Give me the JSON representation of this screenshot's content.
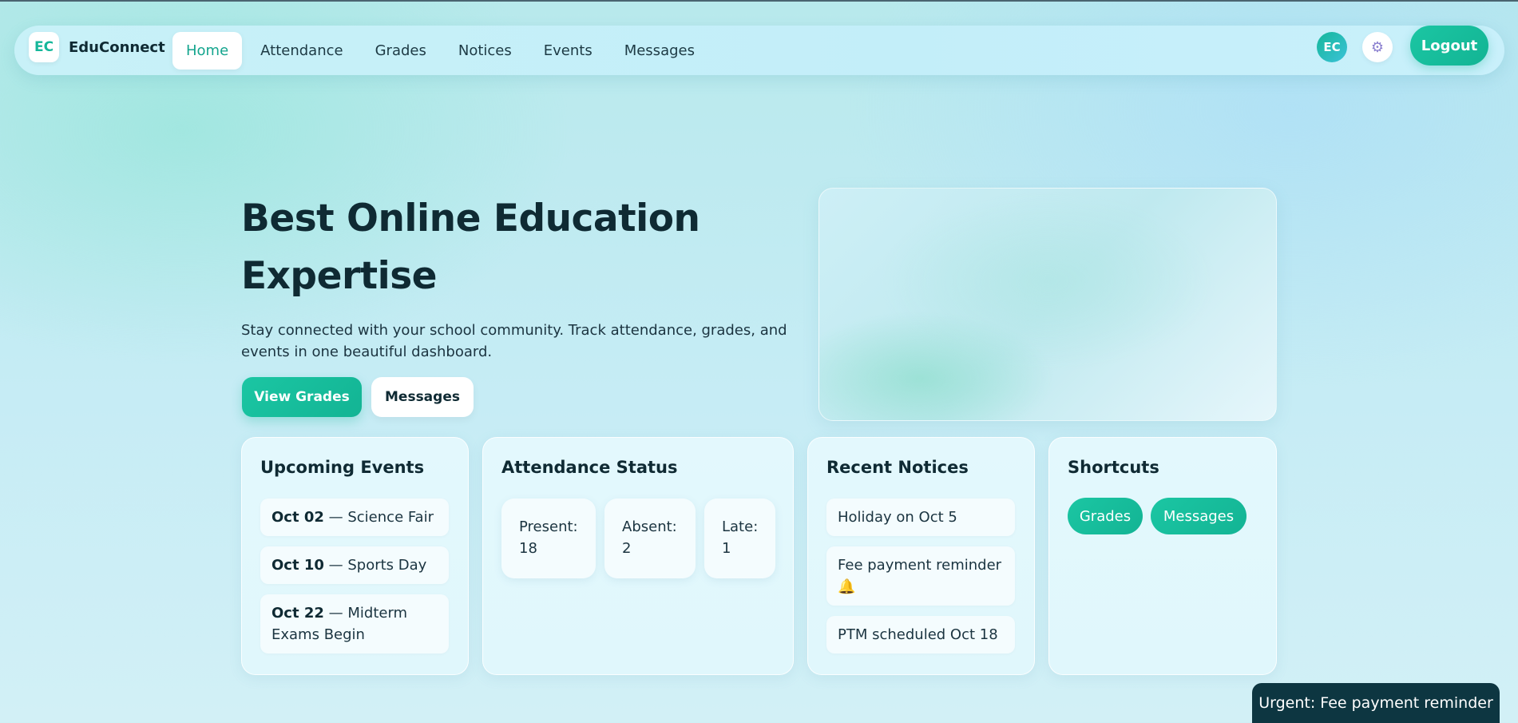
{
  "brand": {
    "logo_text": "EC",
    "name": "EduConnect"
  },
  "nav": {
    "links": [
      "Home",
      "Attendance",
      "Grades",
      "Notices",
      "Events",
      "Messages"
    ],
    "avatar_initials": "EC",
    "settings_icon": "⚙",
    "logout_label": "Logout"
  },
  "hero": {
    "title": "Best Online Education Expertise",
    "subtitle": "Stay connected with your school community. Track attendance, grades, and events in one beautiful dashboard.",
    "primary_button": "View Grades",
    "secondary_button": "Messages"
  },
  "events": {
    "title": "Upcoming Events",
    "items": [
      {
        "date": "Oct 02",
        "text": "— Science Fair"
      },
      {
        "date": "Oct 10",
        "text": "— Sports Day"
      },
      {
        "date": "Oct 22",
        "text": "— Midterm Exams Begin"
      }
    ]
  },
  "attendance": {
    "title": "Attendance Status",
    "stats": [
      {
        "label": "Present:",
        "value": "18"
      },
      {
        "label": "Absent:",
        "value": "2"
      },
      {
        "label": "Late:",
        "value": "1"
      }
    ]
  },
  "notices": {
    "title": "Recent Notices",
    "items": [
      "Holiday on Oct 5",
      "Fee payment reminder 🔔",
      "PTM scheduled Oct 18"
    ]
  },
  "shortcuts": {
    "title": "Shortcuts",
    "items": [
      "Grades",
      "Messages"
    ]
  },
  "toast": {
    "text": "Urgent: Fee payment reminder"
  },
  "colors": {
    "accent": "#15b79a",
    "dark": "#0d3641"
  }
}
